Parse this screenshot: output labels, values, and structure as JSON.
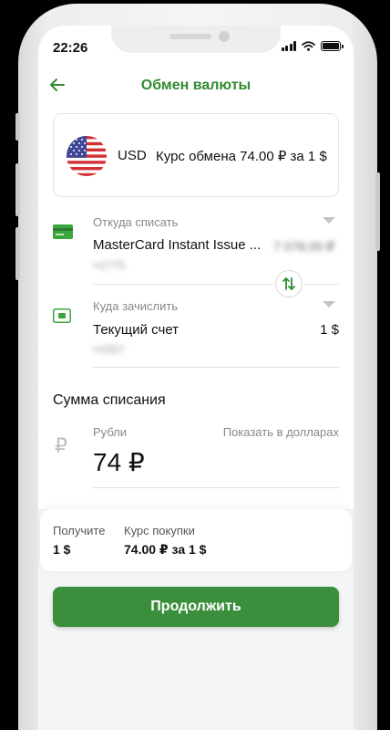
{
  "status_bar": {
    "time": "22:26"
  },
  "header": {
    "title": "Обмен валюты"
  },
  "rate_card": {
    "currency": "USD",
    "rate_text": "Курс обмена 74.00 ₽ за 1 $"
  },
  "from": {
    "label": "Откуда списать",
    "account_name": "MasterCard Instant Issue ...",
    "balance_masked": "7 078.00 ₽",
    "number_masked": "••2775"
  },
  "to": {
    "label": "Куда зачислить",
    "account_name": "Текущий счет",
    "balance": "1 $",
    "number_masked": "••3307"
  },
  "amount": {
    "section_title": "Сумма списания",
    "currency_label": "Рубли",
    "show_usd_link": "Показать в долларах",
    "value": "74 ₽",
    "currency_symbol": "₽"
  },
  "summary": {
    "receive_label": "Получите",
    "receive_value": "1 $",
    "rate_label": "Курс покупки",
    "rate_value": "74.00 ₽ за 1 $"
  },
  "actions": {
    "continue_label": "Продолжить"
  },
  "colors": {
    "accent": "#2f8c31",
    "button": "#3b8f3c"
  },
  "icons": [
    "back-arrow-icon",
    "us-flag-icon",
    "card-icon",
    "account-icon",
    "swap-icon",
    "ruble-icon",
    "chevron-down-icon"
  ]
}
